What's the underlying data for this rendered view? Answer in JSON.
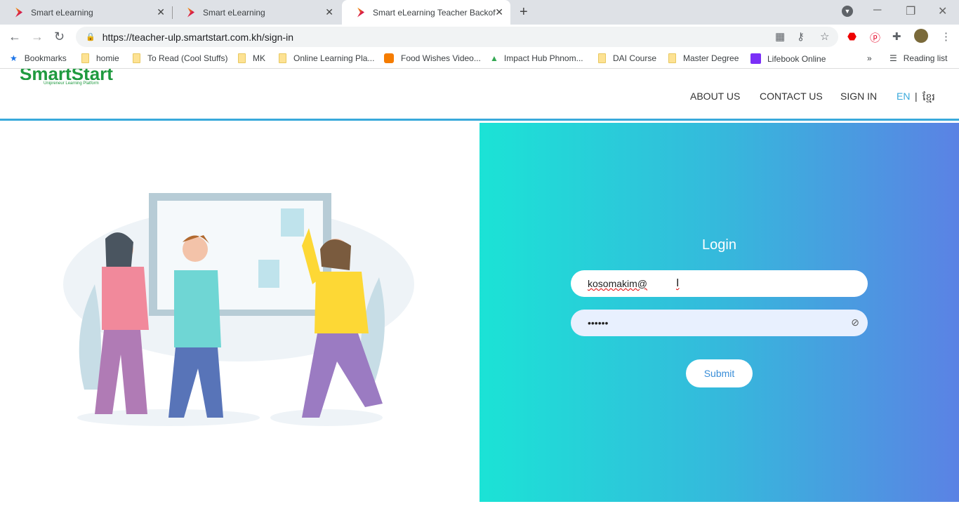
{
  "browser": {
    "tabs": [
      {
        "title": "Smart eLearning"
      },
      {
        "title": "Smart eLearning"
      },
      {
        "title": "Smart eLearning Teacher Backoff"
      }
    ],
    "url": "https://teacher-ulp.smartstart.com.kh/sign-in",
    "bookmarks": [
      "Bookmarks",
      "homie",
      "To Read (Cool Stuffs)",
      "MK",
      "Online Learning Pla...",
      "Food Wishes Video...",
      "Impact Hub Phnom...",
      "DAI Course",
      "Master Degree",
      "Lifebook Online"
    ],
    "reading_list": "Reading list"
  },
  "site": {
    "logo": "SmartStart",
    "tagline": "Unipreneur Learning Platform",
    "menu": {
      "about": "ABOUT US",
      "contact": "CONTACT US",
      "signin": "SIGN IN",
      "en": "EN",
      "sep": "|",
      "km": "ខ្មែរ"
    }
  },
  "login": {
    "title": "Login",
    "email": "kosomakim@",
    "password": "••••••",
    "submit": "Submit"
  },
  "colors": {
    "accent": "#39a9db",
    "grad_start": "#1be3d6",
    "grad_end": "#5b82e4",
    "lang_active": "#39a9db"
  }
}
